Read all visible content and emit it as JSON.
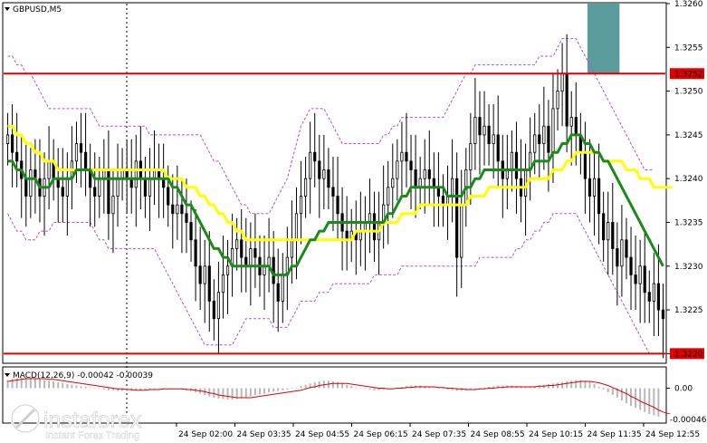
{
  "header": {
    "symbol_label": "GBPUSD,M5",
    "macd_label": "MACD(12,26,9) -0.00042 -0.00039"
  },
  "watermark": {
    "brand": "instaforex",
    "tagline": "Instant Forex Trading"
  },
  "colors": {
    "candle": "#000000",
    "ma_fast": "#1a8a1a",
    "ma_slow": "#ffff00",
    "bollinger": "#b052d6",
    "level_line": "#e00000",
    "zone": "#5b9c9c",
    "macd_hist": "#b8b8b8",
    "macd_signal": "#e00000",
    "price_tag_bg": "#e00000"
  },
  "chart_data": {
    "type": "candlestick",
    "symbol": "GBPUSD",
    "timeframe": "M5",
    "ylim": [
      1.3219,
      1.326
    ],
    "y_ticks": [
      "1.3260",
      "1.3255",
      "1.3250",
      "1.3245",
      "1.3240",
      "1.3235",
      "1.3230",
      "1.3225",
      "1.3220"
    ],
    "x_ticks": [
      "24 Sep 02:00",
      "24 Sep 03:35",
      "24 Sep 04:55",
      "24 Sep 06:15",
      "24 Sep 07:35",
      "24 Sep 08:55",
      "24 Sep 10:15",
      "24 Sep 11:35",
      "24 Sep 12:55"
    ],
    "price_tags": [
      {
        "label": "1.3252",
        "value": 1.3252,
        "highlight": true
      },
      {
        "label": "1.3225",
        "value": 1.3225,
        "highlight": false
      },
      {
        "label": "1.3220",
        "value": 1.322,
        "highlight": true
      }
    ],
    "levels": [
      1.3252,
      1.322
    ],
    "closes": [
      1.3245,
      1.3243,
      1.3242,
      1.324,
      1.3238,
      1.3241,
      1.324,
      1.3238,
      1.324,
      1.3242,
      1.324,
      1.3239,
      1.3238,
      1.324,
      1.3242,
      1.3244,
      1.3243,
      1.3241,
      1.3239,
      1.3238,
      1.324,
      1.3241,
      1.3236,
      1.3238,
      1.324,
      1.3241,
      1.324,
      1.3239,
      1.3242,
      1.324,
      1.3238,
      1.324,
      1.3241,
      1.324,
      1.3239,
      1.3237,
      1.3236,
      1.3237,
      1.3236,
      1.3235,
      1.3233,
      1.323,
      1.3228,
      1.323,
      1.3226,
      1.3224,
      1.3227,
      1.3229,
      1.323,
      1.3232,
      1.3233,
      1.3231,
      1.323,
      1.3232,
      1.3231,
      1.3229,
      1.323,
      1.3231,
      1.3228,
      1.3226,
      1.3229,
      1.3231,
      1.3233,
      1.3236,
      1.3238,
      1.324,
      1.3243,
      1.3242,
      1.324,
      1.3241,
      1.3239,
      1.3238,
      1.3236,
      1.3234,
      1.3233,
      1.3234,
      1.3233,
      1.3234,
      1.3235,
      1.3236,
      1.3233,
      1.3235,
      1.3237,
      1.3239,
      1.324,
      1.3242,
      1.3243,
      1.3242,
      1.3241,
      1.3239,
      1.324,
      1.3241,
      1.324,
      1.3239,
      1.3238,
      1.3237,
      1.3238,
      1.324,
      1.3231,
      1.3237,
      1.3241,
      1.3244,
      1.3247,
      1.3245,
      1.3246,
      1.3244,
      1.3245,
      1.3242,
      1.324,
      1.3241,
      1.3243,
      1.324,
      1.3238,
      1.3241,
      1.3243,
      1.3245,
      1.3244,
      1.3246,
      1.3243,
      1.3248,
      1.325,
      1.3252,
      1.3246,
      1.3247,
      1.3245,
      1.3243,
      1.324,
      1.3238,
      1.324,
      1.3236,
      1.3233,
      1.3235,
      1.3232,
      1.323,
      1.3233,
      1.3231,
      1.3229,
      1.3228,
      1.323,
      1.3227,
      1.3226,
      1.3228,
      1.3225,
      1.3224
    ],
    "ma_fast": [
      1.3242,
      1.3242,
      1.3241,
      1.3241,
      1.324,
      1.324,
      1.324,
      1.3239,
      1.3239,
      1.3239,
      1.324,
      1.324,
      1.324,
      1.324,
      1.324,
      1.3241,
      1.3241,
      1.3241,
      1.3241,
      1.324,
      1.324,
      1.324,
      1.324,
      1.324,
      1.324,
      1.324,
      1.324,
      1.324,
      1.324,
      1.324,
      1.324,
      1.324,
      1.324,
      1.324,
      1.324,
      1.324,
      1.3239,
      1.3239,
      1.3238,
      1.3237,
      1.3237,
      1.3236,
      1.3235,
      1.3234,
      1.3233,
      1.3232,
      1.3232,
      1.3231,
      1.3231,
      1.323,
      1.323,
      1.323,
      1.323,
      1.323,
      1.323,
      1.323,
      1.323,
      1.323,
      1.3229,
      1.3229,
      1.3229,
      1.3229,
      1.323,
      1.323,
      1.3231,
      1.3232,
      1.3233,
      1.3233,
      1.3234,
      1.3234,
      1.3235,
      1.3235,
      1.3235,
      1.3235,
      1.3235,
      1.3235,
      1.3235,
      1.3235,
      1.3235,
      1.3235,
      1.3235,
      1.3235,
      1.3235,
      1.3236,
      1.3236,
      1.3237,
      1.3238,
      1.3238,
      1.3239,
      1.3239,
      1.3239,
      1.3239,
      1.3239,
      1.3239,
      1.3239,
      1.3239,
      1.3238,
      1.3238,
      1.3238,
      1.3238,
      1.3239,
      1.3239,
      1.324,
      1.324,
      1.3241,
      1.3241,
      1.3241,
      1.3241,
      1.3241,
      1.3241,
      1.3241,
      1.3241,
      1.3241,
      1.3241,
      1.3241,
      1.3242,
      1.3242,
      1.3242,
      1.3242,
      1.3243,
      1.3243,
      1.3244,
      1.3244,
      1.3245,
      1.3245,
      1.3245,
      1.3244,
      1.3244,
      1.3243,
      1.3243,
      1.3242,
      1.3242,
      1.3241,
      1.324,
      1.3239,
      1.3238,
      1.3237,
      1.3236,
      1.3235,
      1.3234,
      1.3233,
      1.3232,
      1.3231,
      1.323
    ],
    "ma_slow": [
      1.3246,
      1.3246,
      1.3245,
      1.3245,
      1.3244,
      1.3244,
      1.3243,
      1.3243,
      1.3242,
      1.3242,
      1.3242,
      1.3241,
      1.3241,
      1.3241,
      1.3241,
      1.3241,
      1.3241,
      1.3241,
      1.3241,
      1.3241,
      1.3241,
      1.3241,
      1.3241,
      1.3241,
      1.3241,
      1.3241,
      1.3241,
      1.3241,
      1.3241,
      1.3241,
      1.3241,
      1.3241,
      1.3241,
      1.3241,
      1.3241,
      1.324,
      1.324,
      1.324,
      1.324,
      1.3239,
      1.3239,
      1.3239,
      1.3238,
      1.3238,
      1.3237,
      1.3237,
      1.3236,
      1.3236,
      1.3235,
      1.3235,
      1.3234,
      1.3234,
      1.3233,
      1.3233,
      1.3233,
      1.3233,
      1.3233,
      1.3233,
      1.3233,
      1.3233,
      1.3233,
      1.3233,
      1.3233,
      1.3233,
      1.3233,
      1.3233,
      1.3233,
      1.3233,
      1.3233,
      1.3233,
      1.3233,
      1.3233,
      1.3233,
      1.3233,
      1.3233,
      1.3233,
      1.3234,
      1.3234,
      1.3234,
      1.3234,
      1.3234,
      1.3234,
      1.3235,
      1.3235,
      1.3235,
      1.3235,
      1.3236,
      1.3236,
      1.3236,
      1.3236,
      1.3237,
      1.3237,
      1.3237,
      1.3237,
      1.3237,
      1.3237,
      1.3237,
      1.3237,
      1.3237,
      1.3237,
      1.3237,
      1.3238,
      1.3238,
      1.3238,
      1.3238,
      1.3239,
      1.3239,
      1.3239,
      1.3239,
      1.3239,
      1.3239,
      1.3239,
      1.3239,
      1.3239,
      1.324,
      1.324,
      1.324,
      1.324,
      1.324,
      1.3241,
      1.3241,
      1.3241,
      1.3242,
      1.3242,
      1.3243,
      1.3243,
      1.3243,
      1.3243,
      1.3243,
      1.3243,
      1.3242,
      1.3242,
      1.3242,
      1.3242,
      1.3242,
      1.3241,
      1.3241,
      1.3241,
      1.324,
      1.324,
      1.324,
      1.3239,
      1.3239,
      1.3239,
      1.3239,
      1.3239
    ],
    "bands": {
      "upper": [
        1.3254,
        1.3254,
        1.3253,
        1.3253,
        1.3252,
        1.3252,
        1.3251,
        1.325,
        1.3249,
        1.3248,
        1.3248,
        1.3248,
        1.3248,
        1.3248,
        1.3248,
        1.3248,
        1.3248,
        1.3248,
        1.3248,
        1.3247,
        1.3246,
        1.3246,
        1.3246,
        1.3246,
        1.3246,
        1.3246,
        1.3246,
        1.3246,
        1.3246,
        1.3246,
        1.3246,
        1.3245,
        1.3245,
        1.3245,
        1.3245,
        1.3245,
        1.3245,
        1.3245,
        1.3245,
        1.3245,
        1.3245,
        1.3245,
        1.3245,
        1.3244,
        1.3243,
        1.3242,
        1.3242,
        1.3241,
        1.324,
        1.3239,
        1.3238,
        1.3237,
        1.3237,
        1.3236,
        1.3236,
        1.3236,
        1.3236,
        1.3236,
        1.3237,
        1.3238,
        1.3239,
        1.324,
        1.3242,
        1.3244,
        1.3246,
        1.3247,
        1.3248,
        1.3248,
        1.3248,
        1.3248,
        1.3247,
        1.3246,
        1.3245,
        1.3244,
        1.3244,
        1.3244,
        1.3244,
        1.3244,
        1.3244,
        1.3244,
        1.3244,
        1.3244,
        1.3245,
        1.3245,
        1.3246,
        1.3246,
        1.3247,
        1.3247,
        1.3247,
        1.3247,
        1.3247,
        1.3247,
        1.3247,
        1.3247,
        1.3247,
        1.3247,
        1.3248,
        1.3249,
        1.325,
        1.3251,
        1.3252,
        1.3252,
        1.3253,
        1.3253,
        1.3253,
        1.3253,
        1.3253,
        1.3253,
        1.3253,
        1.3253,
        1.3253,
        1.3253,
        1.3253,
        1.3253,
        1.3253,
        1.3253,
        1.3254,
        1.3254,
        1.3254,
        1.3254,
        1.3255,
        1.3256,
        1.3256,
        1.3256,
        1.3256,
        1.3255,
        1.3254,
        1.3253,
        1.3252,
        1.3251,
        1.325,
        1.3249,
        1.3248,
        1.3247,
        1.3246,
        1.3245,
        1.3244,
        1.3243,
        1.3242,
        1.3241,
        1.3241,
        1.3241
      ],
      "lower": [
        1.3236,
        1.3235,
        1.3234,
        1.3234,
        1.3233,
        1.3233,
        1.3233,
        1.3234,
        1.3234,
        1.3234,
        1.3235,
        1.3235,
        1.3235,
        1.3235,
        1.3235,
        1.3235,
        1.3235,
        1.3235,
        1.3235,
        1.3234,
        1.3233,
        1.3233,
        1.3232,
        1.3232,
        1.3232,
        1.3232,
        1.3232,
        1.3232,
        1.3232,
        1.3232,
        1.3232,
        1.3232,
        1.3232,
        1.3231,
        1.323,
        1.3229,
        1.3228,
        1.3227,
        1.3226,
        1.3225,
        1.3224,
        1.3223,
        1.3222,
        1.3221,
        1.3221,
        1.3221,
        1.3221,
        1.3221,
        1.3221,
        1.3221,
        1.3222,
        1.3223,
        1.3224,
        1.3224,
        1.3224,
        1.3224,
        1.3224,
        1.3224,
        1.3223,
        1.3223,
        1.3223,
        1.3223,
        1.3224,
        1.3225,
        1.3226,
        1.3226,
        1.3226,
        1.3226,
        1.3227,
        1.3227,
        1.3227,
        1.3228,
        1.3228,
        1.3228,
        1.3228,
        1.3228,
        1.3228,
        1.3228,
        1.3228,
        1.3228,
        1.3229,
        1.3229,
        1.3229,
        1.3229,
        1.3229,
        1.3229,
        1.323,
        1.323,
        1.323,
        1.323,
        1.323,
        1.323,
        1.323,
        1.323,
        1.323,
        1.323,
        1.323,
        1.323,
        1.323,
        1.323,
        1.323,
        1.323,
        1.323,
        1.3231,
        1.3231,
        1.3231,
        1.3231,
        1.3231,
        1.3231,
        1.3231,
        1.3231,
        1.3232,
        1.3232,
        1.3233,
        1.3233,
        1.3234,
        1.3234,
        1.3235,
        1.3235,
        1.3236,
        1.3236,
        1.3236,
        1.3236,
        1.3236,
        1.3236,
        1.3235,
        1.3234,
        1.3233,
        1.3232,
        1.3231,
        1.323,
        1.3229,
        1.3228,
        1.3227,
        1.3226,
        1.3225,
        1.3224,
        1.3223,
        1.3222,
        1.3221,
        1.322,
        1.322
      ]
    },
    "zone": {
      "start_index": 127,
      "end_index": 134,
      "low": 1.3252,
      "high": 1.326
    },
    "macd": {
      "ylim": [
        -0.0005,
        0.0003
      ],
      "y_ticks": [
        "0.00",
        "-0.00046"
      ],
      "hist": [
        0.00012,
        0.00014,
        0.00015,
        0.00016,
        0.00016,
        0.00015,
        0.00014,
        0.00013,
        0.00012,
        0.00011,
        0.0001,
        9e-05,
        8e-05,
        6e-05,
        5e-05,
        4e-05,
        3e-05,
        2e-05,
        1e-05,
        0.0,
        -1e-05,
        -2e-05,
        -3e-05,
        -3e-05,
        -4e-05,
        -4e-05,
        -4e-05,
        -4e-05,
        -3e-05,
        -3e-05,
        -2e-05,
        -2e-05,
        -1e-05,
        -1e-05,
        0.0,
        0.0,
        0.0,
        -1e-05,
        -2e-05,
        -3e-05,
        -4e-05,
        -6e-05,
        -8e-05,
        -0.0001,
        -0.00012,
        -0.00014,
        -0.00015,
        -0.00016,
        -0.00017,
        -0.00017,
        -0.00016,
        -0.00015,
        -0.00014,
        -0.00012,
        -0.0001,
        -9e-05,
        -8e-05,
        -6e-05,
        -5e-05,
        -4e-05,
        -3e-05,
        -2e-05,
        -1e-05,
        1e-05,
        3e-05,
        5e-05,
        7e-05,
        9e-05,
        0.0001,
        0.00011,
        0.00011,
        0.0001,
        9e-05,
        7e-05,
        5e-05,
        3e-05,
        1e-05,
        0.0,
        -1e-05,
        -2e-05,
        -3e-05,
        -3e-05,
        -2e-05,
        -1e-05,
        0.0,
        1e-05,
        2e-05,
        3e-05,
        4e-05,
        4e-05,
        4e-05,
        3e-05,
        2e-05,
        1e-05,
        0.0,
        -1e-05,
        -2e-05,
        -3e-05,
        -4e-05,
        -4e-05,
        -3e-05,
        -2e-05,
        -1e-05,
        0.0,
        1e-05,
        2e-05,
        3e-05,
        4e-05,
        4e-05,
        4e-05,
        4e-05,
        3e-05,
        3e-05,
        2e-05,
        2e-05,
        3e-05,
        4e-05,
        5e-05,
        6e-05,
        7e-05,
        8e-05,
        9e-05,
        0.0001,
        0.00011,
        0.00012,
        0.00012,
        0.00011,
        9e-05,
        6e-05,
        2e-05,
        -2e-05,
        -6e-05,
        -0.0001,
        -0.00014,
        -0.00018,
        -0.00022,
        -0.00026,
        -0.00029,
        -0.00032,
        -0.00035,
        -0.00038,
        -0.0004,
        -0.00042
      ],
      "signal": [
        0.0001,
        0.00011,
        0.00012,
        0.00013,
        0.00014,
        0.00014,
        0.00014,
        0.00014,
        0.00014,
        0.00013,
        0.00013,
        0.00012,
        0.00011,
        0.0001,
        9e-05,
        8e-05,
        7e-05,
        6e-05,
        5e-05,
        4e-05,
        3e-05,
        2e-05,
        1e-05,
        0.0,
        -1e-05,
        -1e-05,
        -2e-05,
        -2e-05,
        -3e-05,
        -3e-05,
        -3e-05,
        -2e-05,
        -2e-05,
        -2e-05,
        -1e-05,
        -1e-05,
        -1e-05,
        -1e-05,
        -1e-05,
        -2e-05,
        -2e-05,
        -3e-05,
        -4e-05,
        -5e-05,
        -7e-05,
        -8e-05,
        -0.0001,
        -0.00011,
        -0.00012,
        -0.00013,
        -0.00014,
        -0.00014,
        -0.00014,
        -0.00014,
        -0.00013,
        -0.00012,
        -0.00011,
        -0.0001,
        -9e-05,
        -8e-05,
        -7e-05,
        -6e-05,
        -5e-05,
        -4e-05,
        -3e-05,
        -1e-05,
        1e-05,
        2e-05,
        4e-05,
        5e-05,
        6e-05,
        7e-05,
        7e-05,
        7e-05,
        7e-05,
        6e-05,
        5e-05,
        4e-05,
        3e-05,
        2e-05,
        1e-05,
        0.0,
        0.0,
        -1e-05,
        -1e-05,
        0.0,
        0.0,
        1e-05,
        1e-05,
        2e-05,
        2e-05,
        2e-05,
        2e-05,
        2e-05,
        1e-05,
        1e-05,
        0.0,
        0.0,
        -1e-05,
        -1e-05,
        -2e-05,
        -2e-05,
        -2e-05,
        -1e-05,
        -1e-05,
        0.0,
        0.0,
        1e-05,
        1e-05,
        2e-05,
        2e-05,
        2e-05,
        2e-05,
        2e-05,
        2e-05,
        2e-05,
        3e-05,
        3e-05,
        4e-05,
        4e-05,
        5e-05,
        6e-05,
        7e-05,
        8e-05,
        9e-05,
        0.0001,
        0.0001,
        0.0001,
        9e-05,
        8e-05,
        6e-05,
        4e-05,
        1e-05,
        -2e-05,
        -5e-05,
        -8e-05,
        -0.00012,
        -0.00015,
        -0.00019,
        -0.00022,
        -0.00025,
        -0.00028,
        -0.00032,
        -0.00035,
        -0.00037,
        -0.00039
      ]
    }
  }
}
